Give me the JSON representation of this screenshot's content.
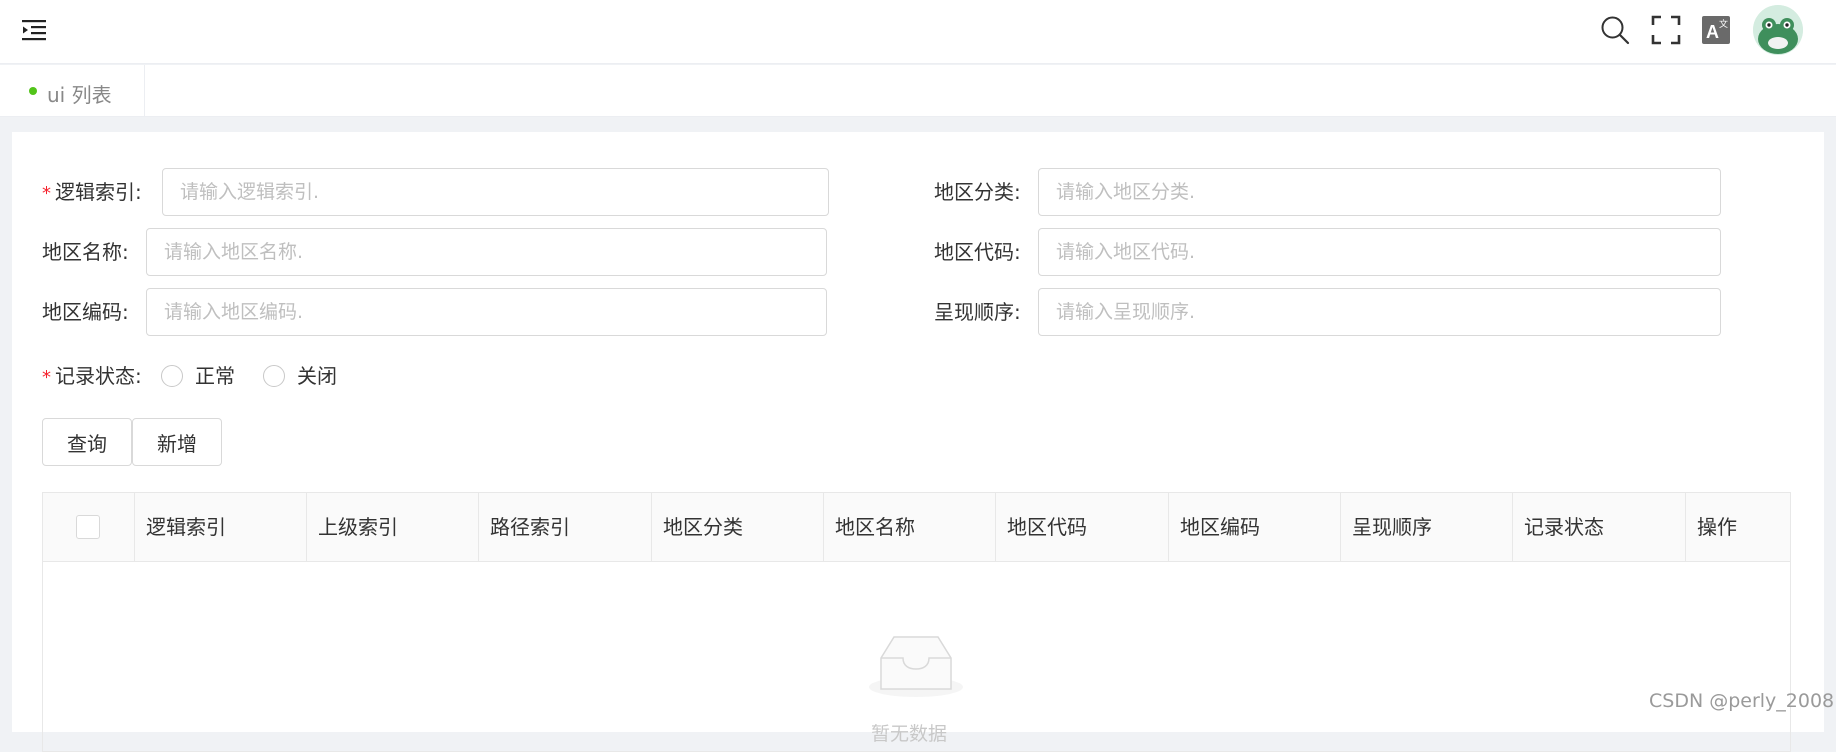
{
  "header": {
    "icons": [
      "menu-fold-icon",
      "search-icon",
      "fullscreen-icon",
      "translate-icon",
      "avatar"
    ]
  },
  "tabs": [
    {
      "label": "ui 列表",
      "active": true,
      "dot_color": "#52c41a"
    }
  ],
  "form": {
    "logical_index": {
      "label": "逻辑索引:",
      "placeholder": "请输入逻辑索引.",
      "required": true
    },
    "region_category": {
      "label": "地区分类:",
      "placeholder": "请输入地区分类."
    },
    "region_name": {
      "label": "地区名称:",
      "placeholder": "请输入地区名称."
    },
    "region_code": {
      "label": "地区代码:",
      "placeholder": "请输入地区代码."
    },
    "region_encoding": {
      "label": "地区编码:",
      "placeholder": "请输入地区编码."
    },
    "display_order": {
      "label": "呈现顺序:",
      "placeholder": "请输入呈现顺序."
    },
    "record_status": {
      "label": "记录状态:",
      "required": true,
      "options": [
        "正常",
        "关闭"
      ]
    },
    "buttons": {
      "query": "查询",
      "add": "新增"
    }
  },
  "table": {
    "columns": [
      "逻辑索引",
      "上级索引",
      "路径索引",
      "地区分类",
      "地区名称",
      "地区代码",
      "地区编码",
      "呈现顺序",
      "记录状态",
      "操作"
    ],
    "rows": [],
    "empty_text": "暂无数据"
  },
  "watermark": "CSDN @perly_2008",
  "colors": {
    "required": "#f5222d",
    "active_dot": "#52c41a",
    "page_bg": "#f0f2f5"
  }
}
